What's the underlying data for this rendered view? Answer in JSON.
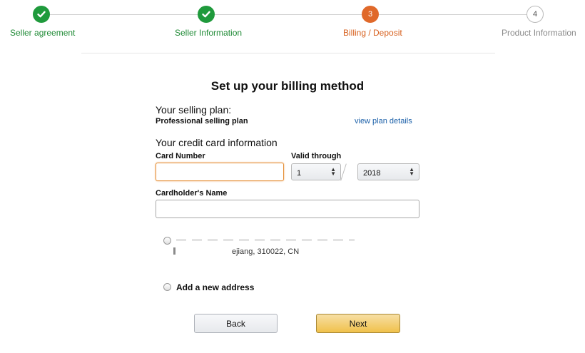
{
  "progress": {
    "steps": [
      {
        "label": "Seller agreement",
        "state": "done",
        "icon": "check-icon"
      },
      {
        "label": "Seller Information",
        "state": "done",
        "icon": "check-icon"
      },
      {
        "number": "3",
        "label": "Billing / Deposit",
        "state": "current"
      },
      {
        "number": "4",
        "label": "Product Information",
        "state": "todo"
      }
    ],
    "colors": {
      "done": "#1f9a3c",
      "current": "#e0692a",
      "todo": "#b9b9b9"
    }
  },
  "page": {
    "title": "Set up your billing method"
  },
  "plan": {
    "heading": "Your selling plan:",
    "name": "Professional selling plan",
    "details_link": "view plan details"
  },
  "card": {
    "heading": "Your credit card information",
    "number_label": "Card Number",
    "number_value": "",
    "valid_label": "Valid through",
    "month_selected": "1",
    "year_selected": "2018",
    "holder_label": "Cardholder's Name",
    "holder_value": ""
  },
  "address": {
    "existing_partial": "ejiang, 310022, CN",
    "add_new_label": "Add a new address"
  },
  "actions": {
    "back_label": "Back",
    "next_label": "Next"
  },
  "accent_colors": {
    "link": "#1a5fa8",
    "next_button": "#f0c14b",
    "focus_border": "#e5913a"
  }
}
